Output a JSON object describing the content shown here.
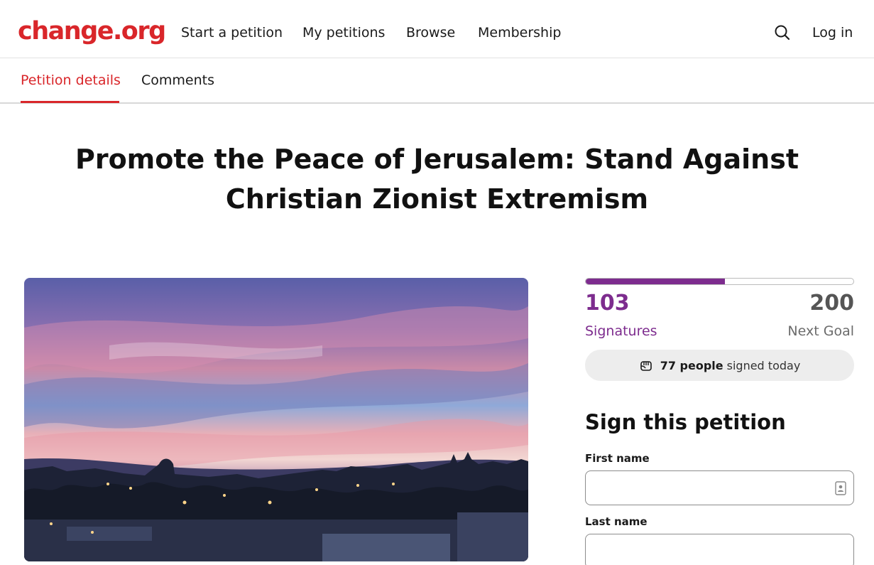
{
  "header": {
    "logo": "change.org",
    "nav": [
      "Start a petition",
      "My petitions",
      "Browse",
      "Membership"
    ],
    "login": "Log in",
    "search_icon": "search-icon"
  },
  "tabs": {
    "details": "Petition details",
    "comments": "Comments",
    "active": "Petition details"
  },
  "petition": {
    "title": "Promote the Peace of Jerusalem: Stand Against Christian Zionist Extremism"
  },
  "stats": {
    "signatures": "103",
    "signatures_label": "Signatures",
    "goal": "200",
    "goal_label": "Next Goal",
    "progress_fraction": 0.52,
    "today_count": "77 people",
    "today_text": "signed today"
  },
  "form": {
    "heading": "Sign this petition",
    "first_name_label": "First name",
    "first_name_value": "",
    "last_name_label": "Last name",
    "last_name_value": ""
  },
  "colors": {
    "brand_red": "#d9262a",
    "accent_purple": "#7d2c8e"
  }
}
